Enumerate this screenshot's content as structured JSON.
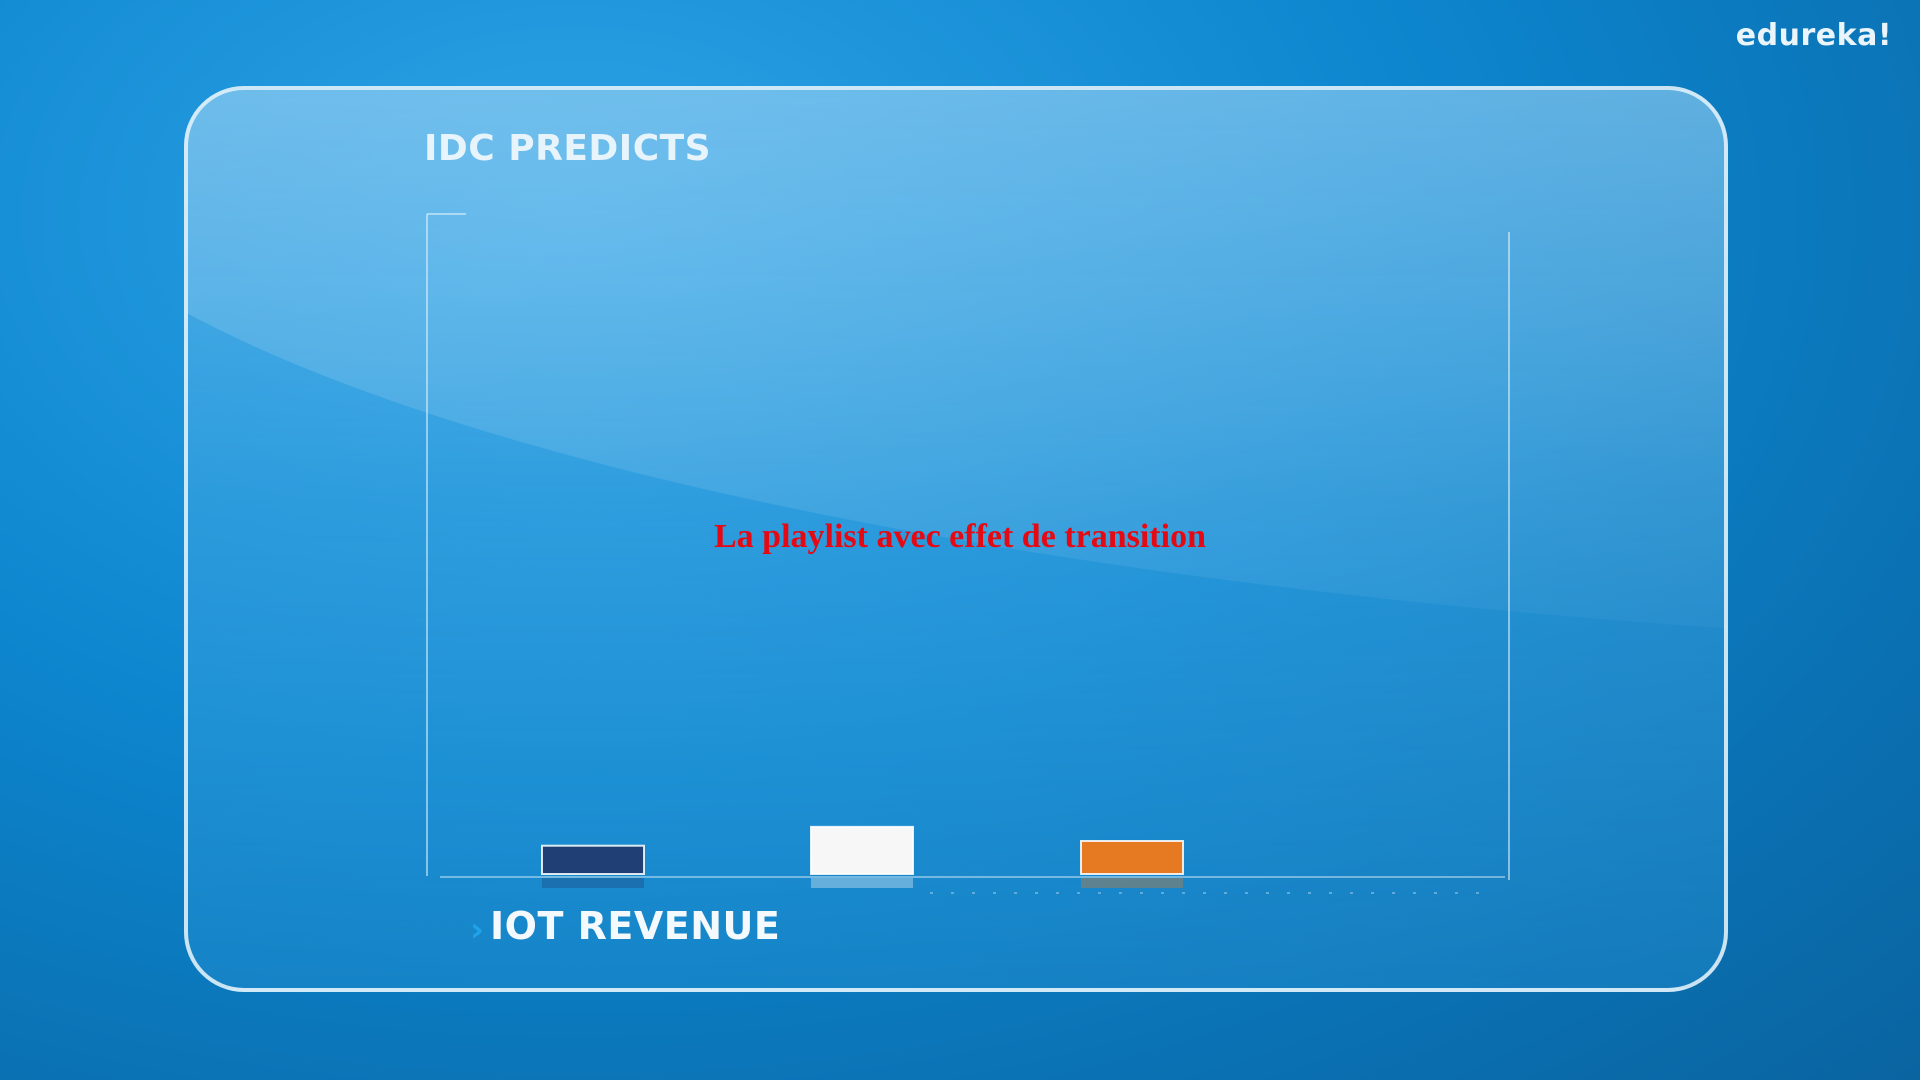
{
  "logo": "edureka!",
  "overlay_text": "La playlist avec effet de transition",
  "footer": {
    "arrow": "›",
    "label": "IOT REVENUE"
  },
  "colors": {
    "bar_1": "#1f3f75",
    "bar_2": "#f7f7f7",
    "bar_3": "#e57a22",
    "overlay_text": "#e50914",
    "accent": "#1fa3e8"
  },
  "chart_data": {
    "type": "bar",
    "title": "IDC PREDICTS",
    "xlabel": "IOT REVENUE",
    "ylabel": "",
    "categories": [
      "",
      "",
      ""
    ],
    "values": [
      3,
      5,
      3.5
    ],
    "ylim": [
      0,
      70
    ],
    "grid": false,
    "legend": "none"
  }
}
